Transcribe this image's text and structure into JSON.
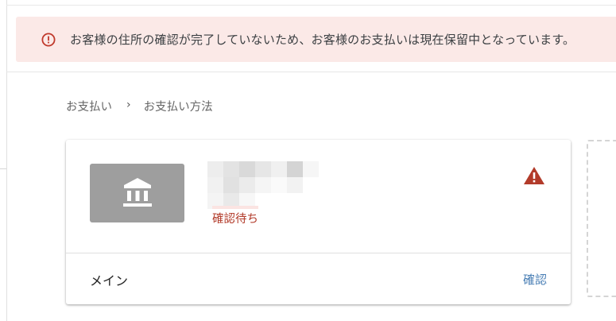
{
  "alert": {
    "icon": "alert-circle-icon",
    "color": "#c0392b",
    "background": "#fbe9e7",
    "message": "お客様の住所の確認が完了していないため、お客様のお支払いは現在保留中となっています。"
  },
  "breadcrumb": {
    "items": [
      "お支払い",
      "お支払い方法"
    ],
    "separator": "›"
  },
  "payment_method": {
    "type_icon": "bank-icon",
    "tile_color": "#9e9e9e",
    "status": "確認待ち",
    "status_color": "#b23b2a",
    "warning_icon": "warning-triangle-icon",
    "label": "メイン",
    "action_label": "確認",
    "action_color": "#4a7fb5"
  }
}
